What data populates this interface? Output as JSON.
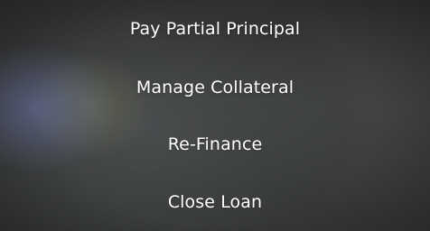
{
  "menu": {
    "items": [
      {
        "label": "Pay Partial Principal"
      },
      {
        "label": "Manage Collateral"
      },
      {
        "label": "Re-Finance"
      },
      {
        "label": "Close Loan"
      }
    ]
  }
}
